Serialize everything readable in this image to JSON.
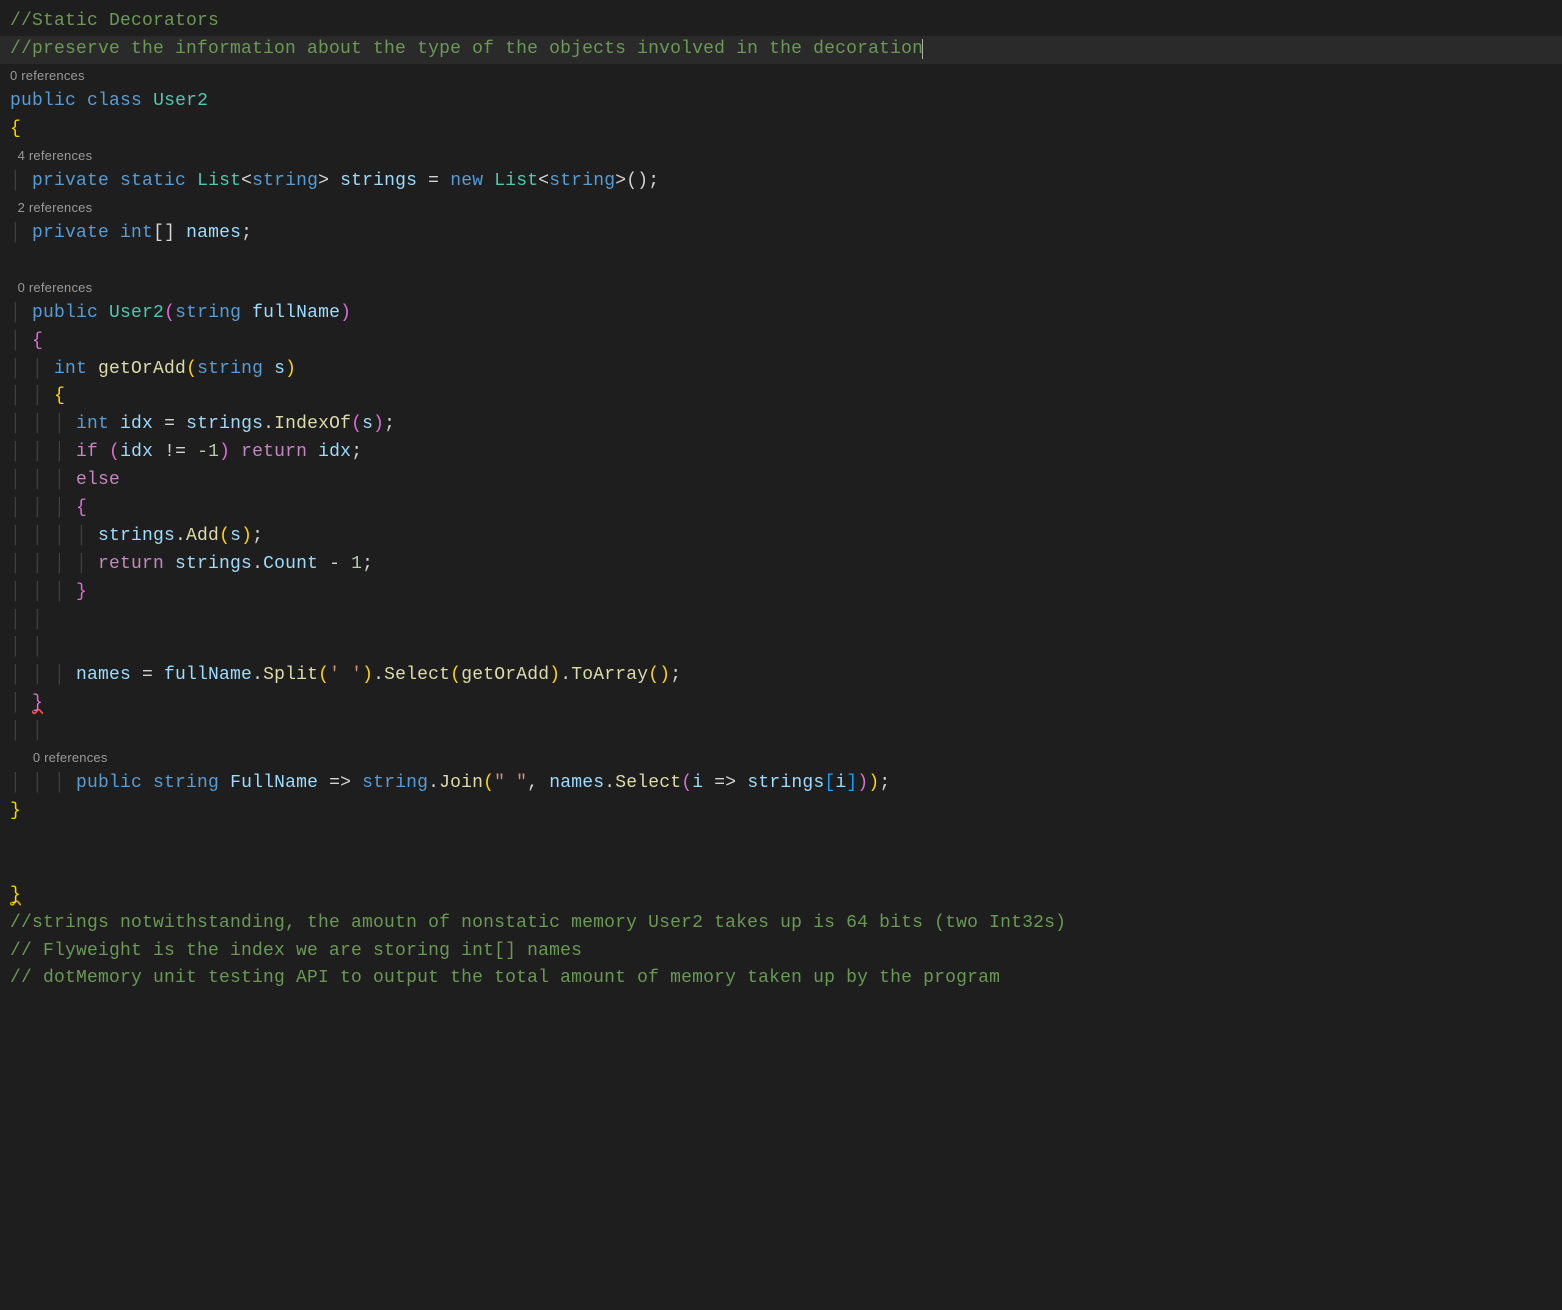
{
  "codelens": {
    "ref0": "0 references",
    "ref4": "4 references",
    "ref2": "2 references"
  },
  "code": {
    "l1_comment": "//Static Decorators",
    "l2_comment": "//preserve the information about the type of the objects involved in the decoration",
    "l3_public": "public",
    "l3_class": "class",
    "l3_User2": "User2",
    "l4_brace": "{",
    "l6_private": "private",
    "l6_static": "static",
    "l6_List": "List",
    "l6_string": "string",
    "l6_strings": "strings",
    "l6_eq": " = ",
    "l6_new": "new",
    "l6_end": "();",
    "l8_private": "private",
    "l8_int": "int",
    "l8_brackets": "[]",
    "l8_names": "names",
    "l8_semi": ";",
    "l11_public": "public",
    "l11_User2": "User2",
    "l11_string": "string",
    "l11_fullName": "fullName",
    "l12_brace": "{",
    "l13_int": "int",
    "l13_getOrAdd": "getOrAdd",
    "l13_string": "string",
    "l13_s": "s",
    "l14_brace": "{",
    "l15_int": "int",
    "l15_idx": "idx",
    "l15_eq": " = ",
    "l15_strings": "strings",
    "l15_IndexOf": "IndexOf",
    "l15_s": "s",
    "l16_if": "if",
    "l16_idx": "idx",
    "l16_ne": " != ",
    "l16_neg1": "-1",
    "l16_return": "return",
    "l16_idx2": "idx",
    "l17_else": "else",
    "l18_brace": "{",
    "l19_strings": "strings",
    "l19_Add": "Add",
    "l19_s": "s",
    "l20_return": "return",
    "l20_strings": "strings",
    "l20_Count": "Count",
    "l20_minus": " - ",
    "l20_one": "1",
    "l21_brace": "}",
    "l24_names": "names",
    "l24_eq": " = ",
    "l24_fullName": "fullName",
    "l24_Split": "Split",
    "l24_space": "' '",
    "l24_Select": "Select",
    "l24_getOrAdd": "getOrAdd",
    "l24_ToArray": "ToArray",
    "l25_brace": "}",
    "l27_public": "public",
    "l27_string": "string",
    "l27_FullName": "FullName",
    "l27_arrow": " => ",
    "l27_string2": "string",
    "l27_Join": "Join",
    "l27_sep": "\" \"",
    "l27_names": "names",
    "l27_Select": "Select",
    "l27_i": "i",
    "l27_arrow2": " => ",
    "l27_strings": "strings",
    "l27_i2": "i",
    "l28_brace": "}",
    "l31_brace": "}",
    "l32_comment": "//strings notwithstanding, the amoutn of nonstatic memory User2 takes up is 64 bits (two Int32s)",
    "l33_comment": "// Flyweight is the index we are storing int[] names",
    "l34_comment": "// dotMemory unit testing API to output the total amount of memory taken up by the program"
  }
}
